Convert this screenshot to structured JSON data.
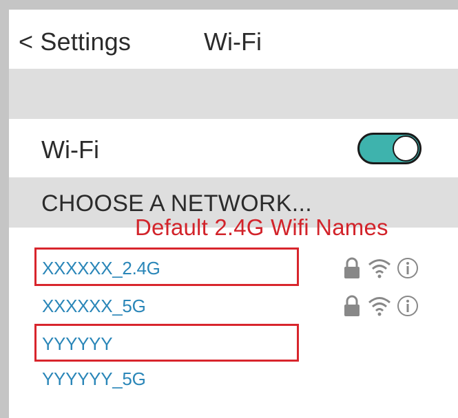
{
  "nav": {
    "back_label": "< Settings",
    "title": "Wi-Fi"
  },
  "wifi": {
    "label": "Wi-Fi",
    "enabled": true,
    "toggle_color": "#3eb3ad"
  },
  "section": {
    "header": "CHOOSE A NETWORK..."
  },
  "annotation": {
    "text": "Default 2.4G Wifi Names",
    "color": "#d2232a"
  },
  "networks": [
    {
      "name": "XXXXXX_2.4G",
      "locked": true,
      "highlighted": true
    },
    {
      "name": "XXXXXX_5G",
      "locked": true,
      "highlighted": false
    },
    {
      "name": "YYYYYY",
      "locked": false,
      "highlighted": true
    },
    {
      "name": "YYYYYY_5G",
      "locked": false,
      "highlighted": false
    }
  ],
  "icons": [
    "lock-icon",
    "wifi-signal-icon",
    "info-icon"
  ],
  "colors": {
    "network_text": "#2a86b8",
    "highlight_box": "#d8252c"
  }
}
